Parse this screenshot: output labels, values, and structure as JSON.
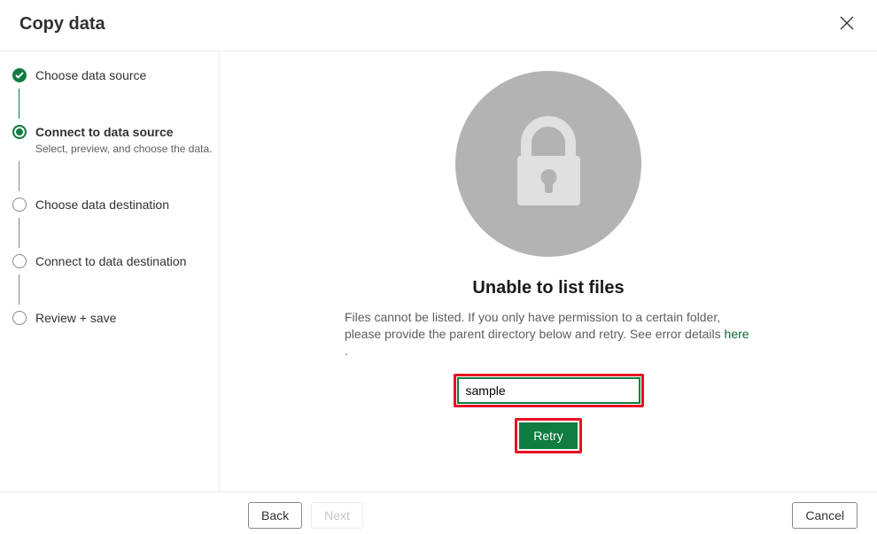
{
  "header": {
    "title": "Copy data"
  },
  "sidebar": {
    "steps": [
      {
        "title": "Choose data source"
      },
      {
        "title": "Connect to data source",
        "subtitle": "Select, preview, and choose the data."
      },
      {
        "title": "Choose data destination"
      },
      {
        "title": "Connect to data destination"
      },
      {
        "title": "Review + save"
      }
    ]
  },
  "main": {
    "heading": "Unable to list files",
    "message_pre": "Files cannot be listed. If you only have permission to a certain folder, please provide the parent directory below and retry. See error details ",
    "message_link": "here",
    "message_post": " .",
    "input_value": "sample",
    "retry_label": "Retry"
  },
  "footer": {
    "back": "Back",
    "next": "Next",
    "cancel": "Cancel"
  }
}
